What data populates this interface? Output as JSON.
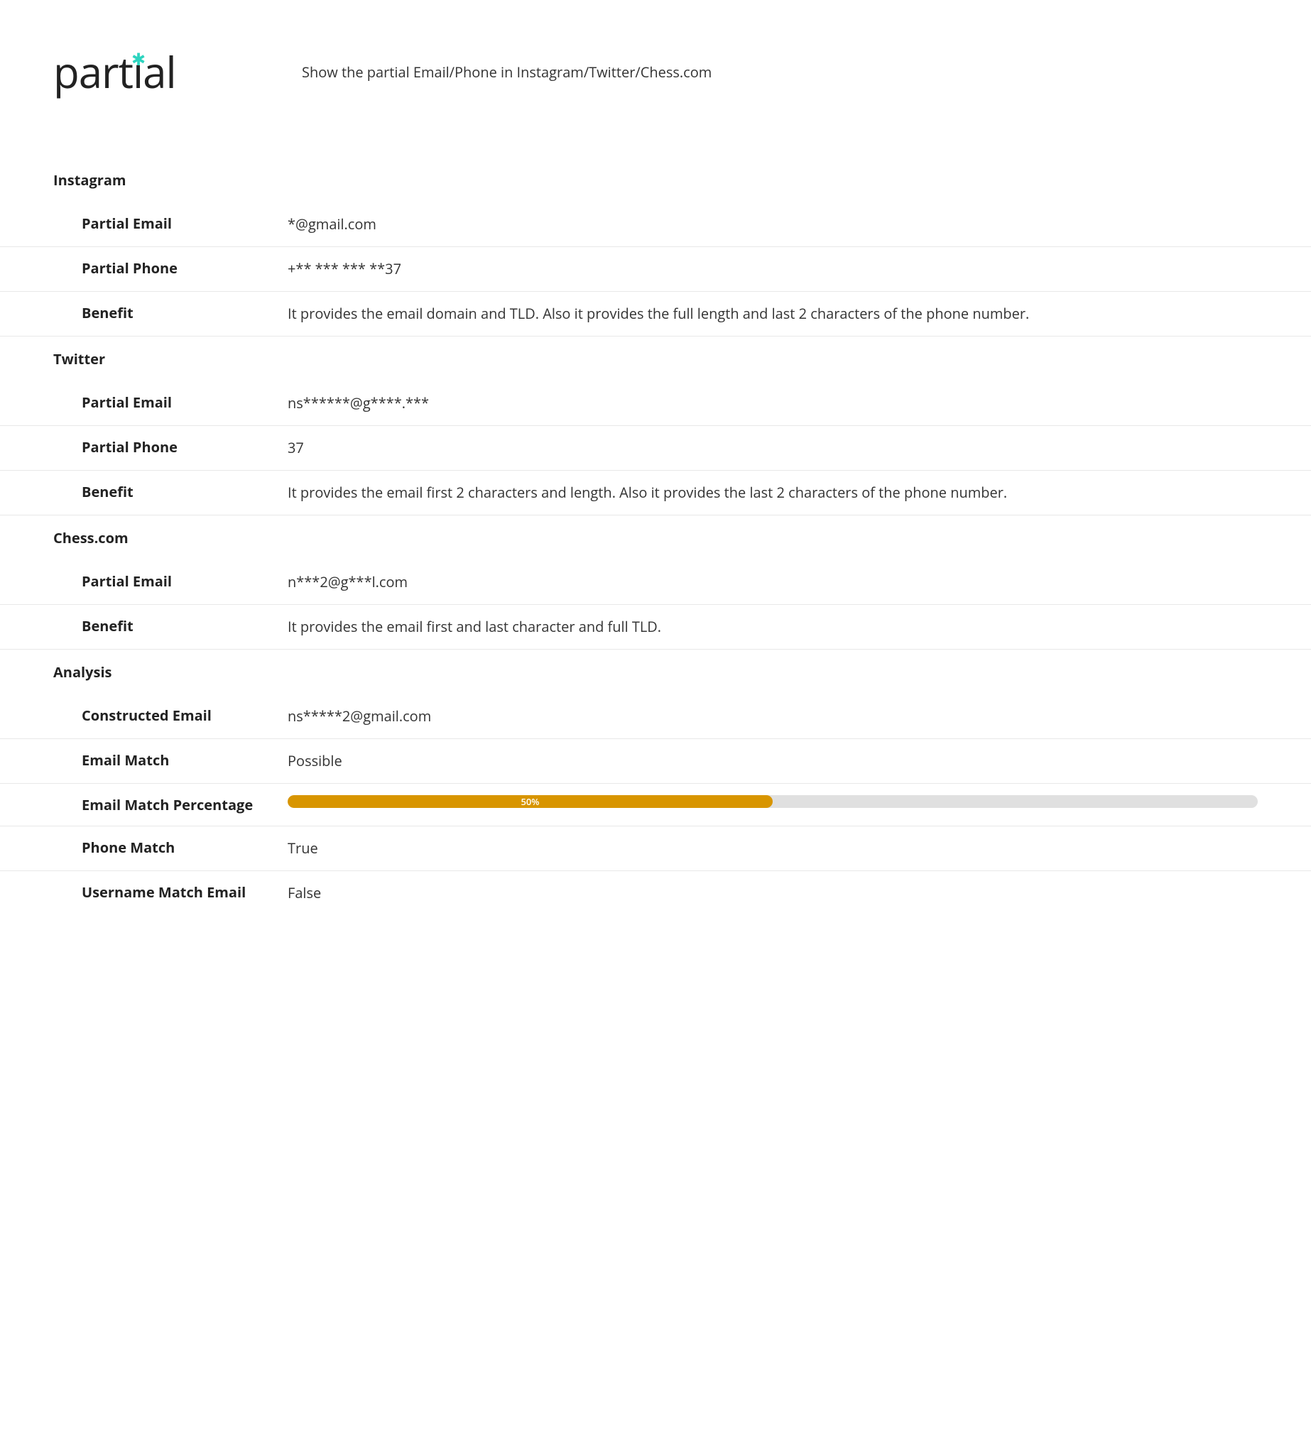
{
  "logo": {
    "text": "partial"
  },
  "description": "Show the partial Email/Phone in Instagram/Twitter/Chess.com",
  "sections": {
    "instagram": {
      "title": "Instagram",
      "partialEmail": {
        "label": "Partial Email",
        "value": "*@gmail.com"
      },
      "partialPhone": {
        "label": "Partial Phone",
        "value": "+** *** *** **37"
      },
      "benefit": {
        "label": "Benefit",
        "value": "It provides the email domain and TLD. Also it provides the full length and last 2 characters of the phone number."
      }
    },
    "twitter": {
      "title": "Twitter",
      "partialEmail": {
        "label": "Partial Email",
        "value": "ns******@g****.***"
      },
      "partialPhone": {
        "label": "Partial Phone",
        "value": "37"
      },
      "benefit": {
        "label": "Benefit",
        "value": "It provides the email first 2 characters and length. Also it provides the last 2 characters of the phone number."
      }
    },
    "chesscom": {
      "title": "Chess.com",
      "partialEmail": {
        "label": "Partial Email",
        "value": "n***2@g***l.com"
      },
      "benefit": {
        "label": "Benefit",
        "value": "It provides the email first and last character and full TLD."
      }
    },
    "analysis": {
      "title": "Analysis",
      "constructedEmail": {
        "label": "Constructed Email",
        "value": "ns*****2@gmail.com"
      },
      "emailMatch": {
        "label": "Email Match",
        "value": "Possible"
      },
      "emailMatchPercentage": {
        "label": "Email Match Percentage",
        "value": "50%",
        "width": "50%"
      },
      "phoneMatch": {
        "label": "Phone Match",
        "value": "True"
      },
      "usernameMatchEmail": {
        "label": "Username Match Email",
        "value": "False"
      }
    }
  }
}
